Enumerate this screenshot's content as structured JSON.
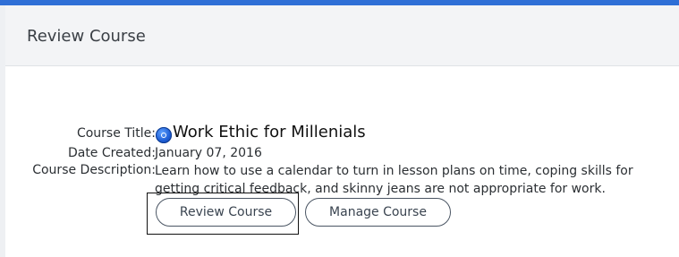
{
  "panel": {
    "title": "Review Course"
  },
  "course": {
    "title_label": "Course Title:",
    "title": "Work Ethic for Millenials",
    "title_icon": "blue-disc-icon",
    "date_label": "Date Created:",
    "date": "January 07, 2016",
    "description_label": "Course Description:",
    "description": "Learn how to use a calendar to turn in lesson plans on time, coping skills for getting critical feedback, and skinny jeans are not appropriate for work."
  },
  "actions": {
    "review_label": "Review Course",
    "manage_label": "Manage Course"
  },
  "colors": {
    "accent": "#2f6fd6",
    "button_border": "#4a5563"
  }
}
